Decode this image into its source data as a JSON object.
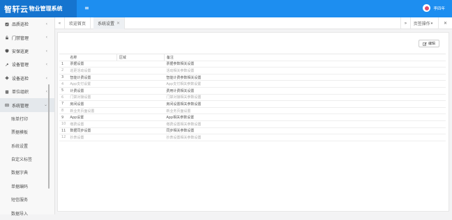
{
  "app": {
    "title_big": "智轩云",
    "title_small": "物业管理系统",
    "username": "李四年"
  },
  "sidebar": {
    "items": [
      {
        "label": "品质巡检"
      },
      {
        "label": "门禁管理"
      },
      {
        "label": "安保巡更"
      },
      {
        "label": "设备管理"
      },
      {
        "label": "设备巡检"
      },
      {
        "label": "单位组织"
      },
      {
        "label": "系统管理"
      }
    ],
    "subitems": [
      {
        "label": "账单打印"
      },
      {
        "label": "票据模板"
      },
      {
        "label": "系统设置"
      },
      {
        "label": "自定义标签"
      },
      {
        "label": "数据字典"
      },
      {
        "label": "单据编码"
      },
      {
        "label": "短信服务"
      },
      {
        "label": "数据导入"
      }
    ]
  },
  "tabs": {
    "welcome": "欢迎首页",
    "system_settings": "系统设置",
    "page_ops": "页签操作"
  },
  "toolbar": {
    "edit_label": "编辑"
  },
  "table": {
    "headers": {
      "name": "名称",
      "area": "区域",
      "remark": "备注"
    },
    "rows": [
      {
        "idx": "1",
        "name": "票据设置",
        "area": "",
        "remark": "票据参数相关设置",
        "dim": false
      },
      {
        "idx": "2",
        "name": "巡更活动设置",
        "area": "",
        "remark": "活动相关参数设置",
        "dim": true
      },
      {
        "idx": "3",
        "name": "智能计费设置",
        "area": "",
        "remark": "智能计费参数相关设置",
        "dim": false
      },
      {
        "idx": "4",
        "name": "App支付设置",
        "area": "",
        "remark": "App支付相关参数设置",
        "dim": true
      },
      {
        "idx": "5",
        "name": "计费设置",
        "area": "",
        "remark": "费用计费相关设置",
        "dim": false
      },
      {
        "idx": "6",
        "name": "门禁对接设置",
        "area": "",
        "remark": "门禁对接相关参数设置",
        "dim": true
      },
      {
        "idx": "7",
        "name": "房间设置",
        "area": "",
        "remark": "房间设置相关参数设置",
        "dim": false
      },
      {
        "idx": "8",
        "name": "新业务页面设置",
        "area": "",
        "remark": "新业务页面设置",
        "dim": true
      },
      {
        "idx": "9",
        "name": "App设置",
        "area": "",
        "remark": "App相关参数设置",
        "dim": false
      },
      {
        "idx": "10",
        "name": "缴费设置",
        "area": "",
        "remark": "缴费设置相关参数设置",
        "dim": true
      },
      {
        "idx": "11",
        "name": "数据同步设置",
        "area": "",
        "remark": "同步相关参数设置",
        "dim": false
      },
      {
        "idx": "12",
        "name": "抄表设置",
        "area": "",
        "remark": "抄表设置相关参数设置",
        "dim": true
      }
    ]
  }
}
